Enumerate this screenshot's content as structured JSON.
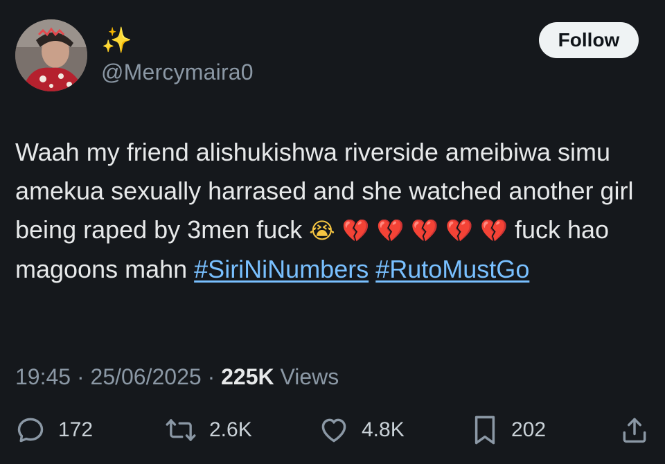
{
  "user": {
    "display_name": "✨",
    "handle": "@Mercymaira0",
    "follow_label": "Follow"
  },
  "tweet": {
    "text_parts": {
      "p1": "Waah my friend alishukishwa riverside ameibiwa simu amekua sexually harrased and she watched another girl being raped by 3men fuck ",
      "cry_emoji": "😭",
      "heart1": "💔",
      "heart2": "💔",
      "heart3": "💔",
      "heart4": "💔",
      "heart5": "💔",
      "p2": " fuck hao magoons mahn ",
      "hashtag1": "#SiriNiNumbers",
      "hashtag2": "#RutoMustGo"
    },
    "time": "19:45",
    "date": "25/06/2025",
    "separator": "·",
    "views_count": "225K",
    "views_label": "Views"
  },
  "actions": {
    "replies": "172",
    "reposts": "2.6K",
    "likes": "4.8K",
    "bookmarks": "202"
  },
  "colors": {
    "background": "#15181c",
    "text": "#e7e9ea",
    "muted": "#8b98a5",
    "hashtag": "#79c0ff",
    "follow_bg": "#eff3f4"
  }
}
